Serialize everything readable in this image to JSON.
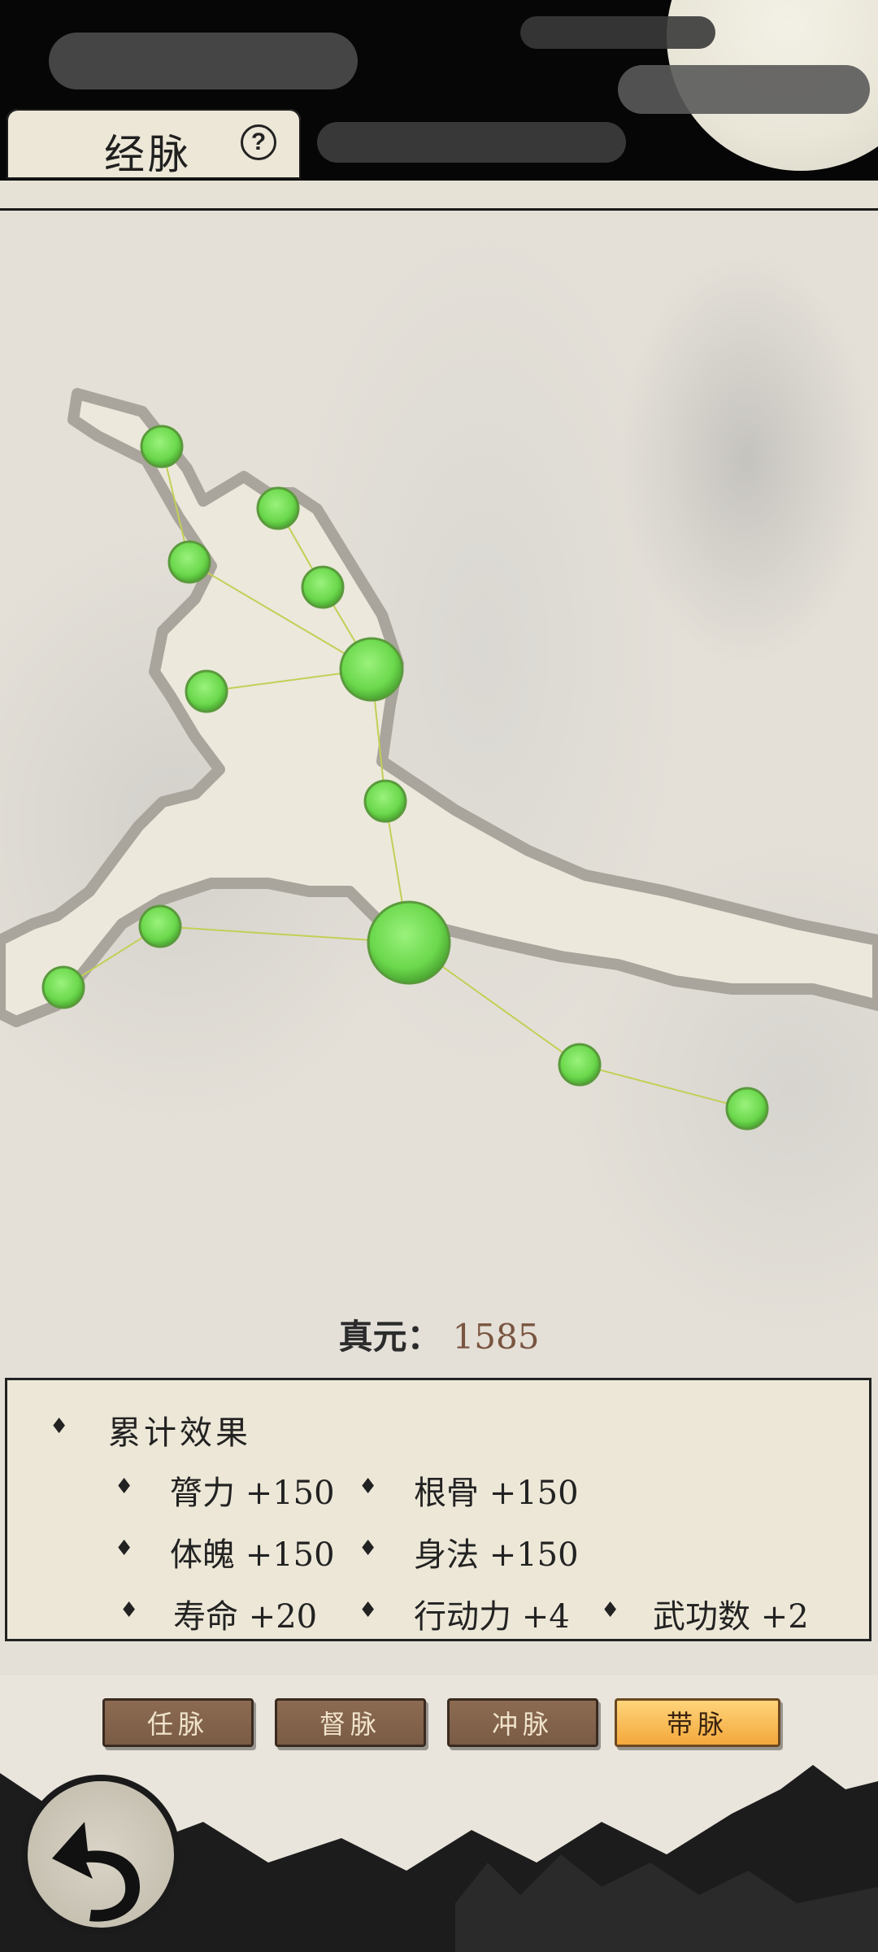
{
  "header": {
    "title": "经脉",
    "help_icon": "?"
  },
  "meridian_nodes": [
    {
      "id": "hand",
      "size": "small"
    },
    {
      "id": "head",
      "size": "small"
    },
    {
      "id": "elbow",
      "size": "small"
    },
    {
      "id": "neck",
      "size": "small"
    },
    {
      "id": "shoulder",
      "size": "large"
    },
    {
      "id": "left-hand",
      "size": "small"
    },
    {
      "id": "waist",
      "size": "small"
    },
    {
      "id": "dantian",
      "size": "xlarge"
    },
    {
      "id": "left-knee",
      "size": "small"
    },
    {
      "id": "left-foot",
      "size": "small"
    },
    {
      "id": "right-knee",
      "size": "small"
    },
    {
      "id": "right-foot",
      "size": "small"
    }
  ],
  "zhenyuan": {
    "label": "真元：",
    "value": "1585"
  },
  "effects": {
    "title": "累计效果",
    "items": [
      {
        "name": "膂力",
        "value": "+150"
      },
      {
        "name": "根骨",
        "value": "+150"
      },
      {
        "name": "体魄",
        "value": "+150"
      },
      {
        "name": "身法",
        "value": "+150"
      },
      {
        "name": "寿命",
        "value": "+20"
      },
      {
        "name": "行动力",
        "value": "+4"
      },
      {
        "name": "武功数",
        "value": "+2"
      }
    ]
  },
  "tabs": [
    {
      "label": "任脉",
      "active": false
    },
    {
      "label": "督脉",
      "active": false
    },
    {
      "label": "冲脉",
      "active": false
    },
    {
      "label": "带脉",
      "active": true
    }
  ],
  "colors": {
    "node_green": "#78e35a",
    "active_tab": "#f3a83c",
    "inactive_tab": "#7a5b44",
    "value_brown": "#7a5540"
  },
  "icons": {
    "back": "back-arrow-icon",
    "help": "question-circle-icon",
    "bullet": "diamond-icon"
  }
}
